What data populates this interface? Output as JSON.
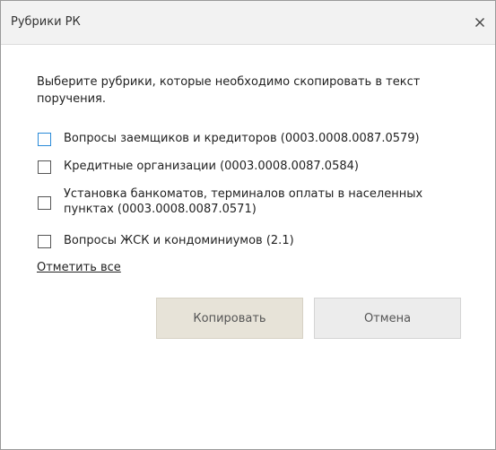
{
  "dialog": {
    "title": "Рубрики РК",
    "intro": "Выберите рубрики, которые необходимо скопировать в текст поручения.",
    "items": [
      {
        "label": "Вопросы заемщиков и кредиторов (0003.0008.0087.0579)",
        "checked": false
      },
      {
        "label": "Кредитные организации (0003.0008.0087.0584)",
        "checked": false
      },
      {
        "label": "Установка банкоматов, терминалов оплаты в населенных пунктах (0003.0008.0087.0571)",
        "checked": false
      },
      {
        "label": "Вопросы ЖСК и кондоминиумов (2.1)",
        "checked": false
      }
    ],
    "mark_all": "Отметить все",
    "copy_label": "Копировать",
    "cancel_label": "Отмена"
  },
  "icons": {
    "close": "close-icon"
  }
}
